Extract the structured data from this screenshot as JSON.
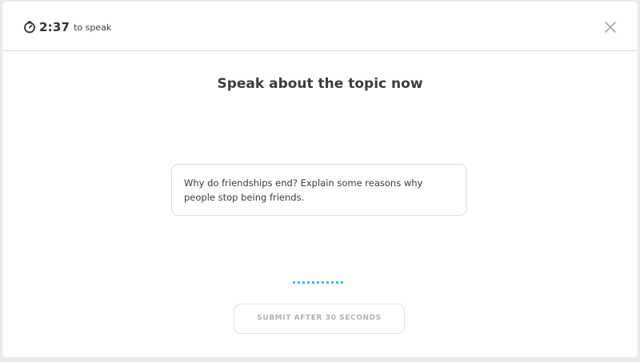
{
  "header": {
    "timer_icon": "clock-icon",
    "timer_value": "2:37",
    "timer_suffix": "to speak",
    "close_icon": "close-icon"
  },
  "main": {
    "title": "Speak about the topic now",
    "prompt": "Why do friendships end? Explain some reasons why people stop being friends.",
    "recording_indicator_icon": "recording-dots-icon",
    "submit_label": "SUBMIT AFTER 30 SECONDS"
  },
  "colors": {
    "accent": "#1cb0f6",
    "text": "#3c3c3c",
    "disabled_text": "#b1b1b1",
    "border": "#dedede"
  }
}
